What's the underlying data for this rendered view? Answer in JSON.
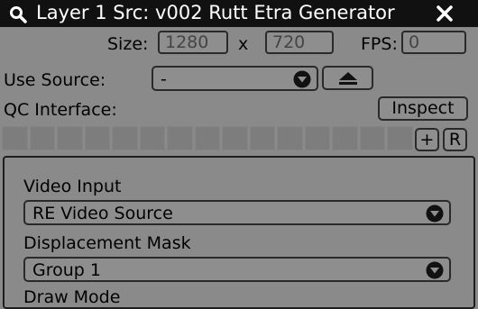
{
  "window": {
    "title": "Layer 1 Src: v002 Rutt Etra Generator"
  },
  "size": {
    "label": "Size:",
    "width": "1280",
    "separator": "x",
    "height": "720"
  },
  "fps": {
    "label": "FPS:",
    "value": "0"
  },
  "use_source": {
    "label": "Use Source:",
    "selected": "-"
  },
  "qc": {
    "label": "QC Interface:",
    "inspect_label": "Inspect",
    "add_label": "+",
    "reset_label": "R"
  },
  "params": {
    "video_input": {
      "label": "Video Input",
      "selected": "RE Video Source"
    },
    "displacement_mask": {
      "label": "Displacement Mask",
      "selected": "Group 1"
    },
    "draw_mode": {
      "label": "Draw Mode"
    }
  },
  "icons": {
    "search": "search-icon",
    "close": "close-icon",
    "dropdown": "chevron-down-icon",
    "eject": "eject-icon"
  }
}
